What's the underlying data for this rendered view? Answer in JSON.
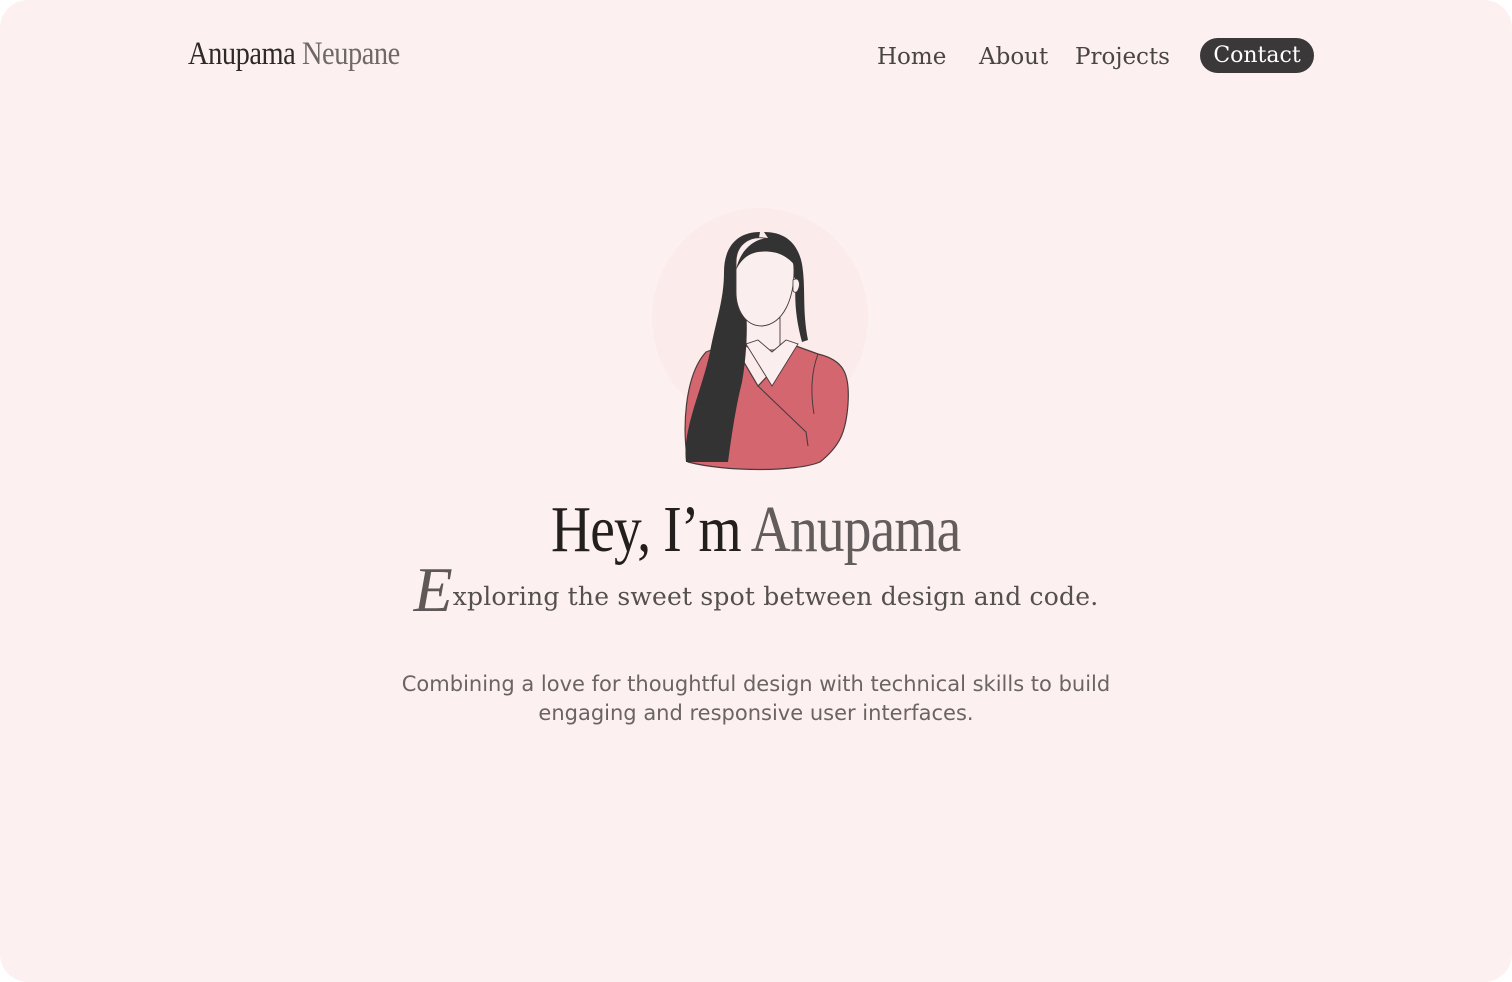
{
  "brand": {
    "first_name": "Anupama",
    "last_name": "Neupane"
  },
  "nav": {
    "home": "Home",
    "about": "About",
    "projects": "Projects",
    "contact": "Contact"
  },
  "hero": {
    "greeting": "Hey, I’m",
    "name": "Anupama",
    "tagline_initial": "E",
    "tagline_rest": "xploring the sweet spot between design and code.",
    "description": "Combining a love for thoughtful design with technical skills to build engaging and responsive user interfaces."
  },
  "colors": {
    "background": "#fdf0f0",
    "contact_button": "#3a3838",
    "top_accent": "#d46670",
    "hair": "#333333"
  },
  "icons": {
    "portrait": "woman-portrait-illustration"
  }
}
